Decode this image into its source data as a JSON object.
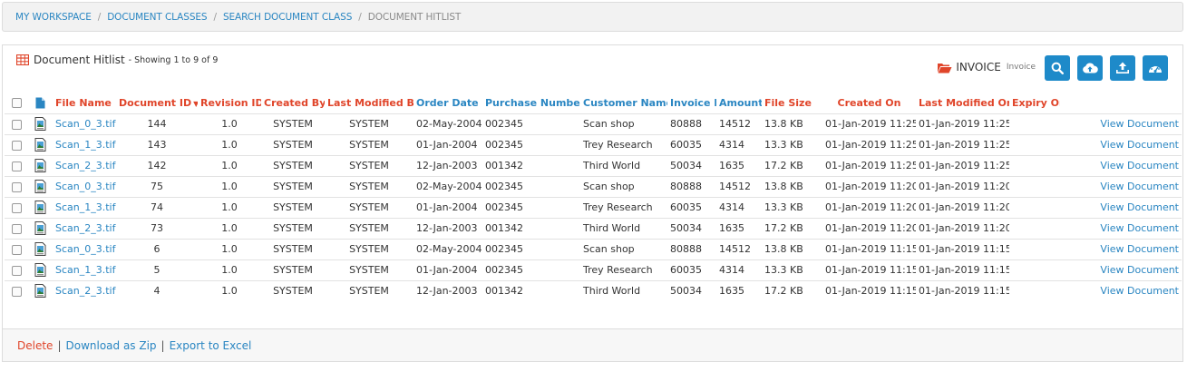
{
  "breadcrumb": [
    "MY WORKSPACE",
    "DOCUMENT CLASSES",
    "SEARCH DOCUMENT CLASS",
    "DOCUMENT HITLIST"
  ],
  "panel": {
    "title": "Document Hitlist",
    "subtitle": "- Showing 1 to 9 of 9",
    "doc_class": "INVOICE",
    "doc_class_sub": "Invoice"
  },
  "toolbar": {
    "icons": [
      "search-icon",
      "cloud-upload-icon",
      "upload-icon",
      "dashboard-icon"
    ]
  },
  "colors": {
    "accent": "#1e8ac9",
    "red_header": "#e0452a",
    "blue_header": "#2a86c2"
  },
  "table": {
    "headers": {
      "file_name": "File Name",
      "document_id": "Document ID",
      "revision_id": "Revision ID",
      "created_by": "Created By",
      "last_modified_by": "Last Modified By",
      "order_date": "Order Date",
      "purchase_number": "Purchase Number",
      "customer_name": "Customer Name",
      "invoice_number": "Invoice Number",
      "amount": "Amount",
      "file_size": "File Size",
      "created_on": "Created On",
      "last_modified_on": "Last Modified On",
      "expiry_on": "Expiry On"
    },
    "rows": [
      {
        "file": "Scan_0_3.tif",
        "doc_id": "144",
        "rev": "1.0",
        "created_by": "SYSTEM",
        "modified_by": "SYSTEM",
        "order_date": "02-May-2004",
        "purchase": "002345",
        "customer": "Scan shop",
        "invoice": "80888",
        "amount": "14512",
        "size": "13.8 KB",
        "created_on": "01-Jan-2019 11:25",
        "modified_on": "01-Jan-2019 11:25",
        "expiry": "",
        "action": "View Document"
      },
      {
        "file": "Scan_1_3.tif",
        "doc_id": "143",
        "rev": "1.0",
        "created_by": "SYSTEM",
        "modified_by": "SYSTEM",
        "order_date": "01-Jan-2004",
        "purchase": "002345",
        "customer": "Trey Research",
        "invoice": "60035",
        "amount": "4314",
        "size": "13.3 KB",
        "created_on": "01-Jan-2019 11:25",
        "modified_on": "01-Jan-2019 11:25",
        "expiry": "",
        "action": "View Document"
      },
      {
        "file": "Scan_2_3.tif",
        "doc_id": "142",
        "rev": "1.0",
        "created_by": "SYSTEM",
        "modified_by": "SYSTEM",
        "order_date": "12-Jan-2003",
        "purchase": "001342",
        "customer": "Third World",
        "invoice": "50034",
        "amount": "1635",
        "size": "17.2 KB",
        "created_on": "01-Jan-2019 11:25",
        "modified_on": "01-Jan-2019 11:25",
        "expiry": "",
        "action": "View Document"
      },
      {
        "file": "Scan_0_3.tif",
        "doc_id": "75",
        "rev": "1.0",
        "created_by": "SYSTEM",
        "modified_by": "SYSTEM",
        "order_date": "02-May-2004",
        "purchase": "002345",
        "customer": "Scan shop",
        "invoice": "80888",
        "amount": "14512",
        "size": "13.8 KB",
        "created_on": "01-Jan-2019 11:20",
        "modified_on": "01-Jan-2019 11:20",
        "expiry": "",
        "action": "View Document"
      },
      {
        "file": "Scan_1_3.tif",
        "doc_id": "74",
        "rev": "1.0",
        "created_by": "SYSTEM",
        "modified_by": "SYSTEM",
        "order_date": "01-Jan-2004",
        "purchase": "002345",
        "customer": "Trey Research",
        "invoice": "60035",
        "amount": "4314",
        "size": "13.3 KB",
        "created_on": "01-Jan-2019 11:20",
        "modified_on": "01-Jan-2019 11:20",
        "expiry": "",
        "action": "View Document"
      },
      {
        "file": "Scan_2_3.tif",
        "doc_id": "73",
        "rev": "1.0",
        "created_by": "SYSTEM",
        "modified_by": "SYSTEM",
        "order_date": "12-Jan-2003",
        "purchase": "001342",
        "customer": "Third World",
        "invoice": "50034",
        "amount": "1635",
        "size": "17.2 KB",
        "created_on": "01-Jan-2019 11:20",
        "modified_on": "01-Jan-2019 11:20",
        "expiry": "",
        "action": "View Document"
      },
      {
        "file": "Scan_0_3.tif",
        "doc_id": "6",
        "rev": "1.0",
        "created_by": "SYSTEM",
        "modified_by": "SYSTEM",
        "order_date": "02-May-2004",
        "purchase": "002345",
        "customer": "Scan shop",
        "invoice": "80888",
        "amount": "14512",
        "size": "13.8 KB",
        "created_on": "01-Jan-2019 11:15",
        "modified_on": "01-Jan-2019 11:15",
        "expiry": "",
        "action": "View Document"
      },
      {
        "file": "Scan_1_3.tif",
        "doc_id": "5",
        "rev": "1.0",
        "created_by": "SYSTEM",
        "modified_by": "SYSTEM",
        "order_date": "01-Jan-2004",
        "purchase": "002345",
        "customer": "Trey Research",
        "invoice": "60035",
        "amount": "4314",
        "size": "13.3 KB",
        "created_on": "01-Jan-2019 11:15",
        "modified_on": "01-Jan-2019 11:15",
        "expiry": "",
        "action": "View Document"
      },
      {
        "file": "Scan_2_3.tif",
        "doc_id": "4",
        "rev": "1.0",
        "created_by": "SYSTEM",
        "modified_by": "SYSTEM",
        "order_date": "12-Jan-2003",
        "purchase": "001342",
        "customer": "Third World",
        "invoice": "50034",
        "amount": "1635",
        "size": "17.2 KB",
        "created_on": "01-Jan-2019 11:15",
        "modified_on": "01-Jan-2019 11:15",
        "expiry": "",
        "action": "View Document"
      }
    ]
  },
  "footer": {
    "delete_label": "Delete",
    "download_label": "Download as Zip",
    "export_label": "Export to Excel"
  }
}
